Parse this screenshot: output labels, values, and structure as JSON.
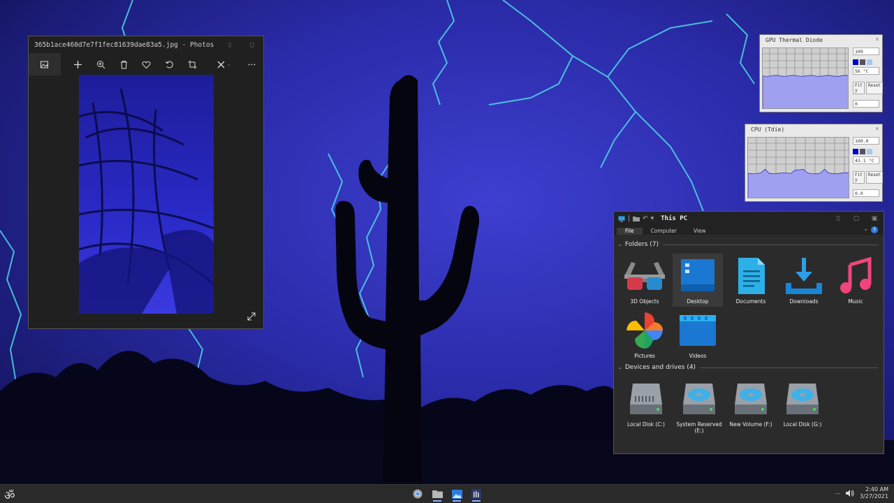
{
  "photos": {
    "title": "365b1ace460d7e7f1fec81639dae83a5.jpg - Photos",
    "toolbar": [
      "image-icon",
      "add-icon",
      "zoom-icon",
      "delete-icon",
      "favorite-icon",
      "rotate-icon",
      "crop-icon",
      "edit-icon",
      "more-icon"
    ]
  },
  "gpu_monitor": {
    "title": "GPU Thermal Diode",
    "max": "100",
    "value": "56 °C",
    "min": "0",
    "fit_label": "Fit y",
    "reset_label": "Reset",
    "fill_level": 0.55,
    "swatch_colors": [
      "#0000c8",
      "#555555",
      "#a8c8f0"
    ]
  },
  "cpu_monitor": {
    "title": "CPU (Tdie)",
    "max": "100.0",
    "value": "43.1 °C",
    "min": "0.0",
    "fit_label": "Fit y",
    "reset_label": "Reset",
    "fill_level": 0.42,
    "swatch_colors": [
      "#0000c8",
      "#555555",
      "#a8c8f0"
    ]
  },
  "explorer": {
    "title": "This PC",
    "tabs": [
      "File",
      "Computer",
      "View"
    ],
    "active_tab": "File",
    "folders_header": "Folders (7)",
    "folders": [
      {
        "label": "3D Objects",
        "icon": "3d-glasses-icon"
      },
      {
        "label": "Desktop",
        "icon": "desktop-icon"
      },
      {
        "label": "Documents",
        "icon": "document-icon"
      },
      {
        "label": "Downloads",
        "icon": "download-icon"
      },
      {
        "label": "Music",
        "icon": "music-icon"
      },
      {
        "label": "Pictures",
        "icon": "pinwheel-icon"
      },
      {
        "label": "Videos",
        "icon": "video-icon"
      }
    ],
    "drives_header": "Devices and drives (4)",
    "drives": [
      {
        "label": "Local Disk (C:)",
        "icon": "hard-drive-icon"
      },
      {
        "label": "System Reserved (E:)",
        "icon": "disc-drive-icon"
      },
      {
        "label": "New Volume (F:)",
        "icon": "disc-drive-icon"
      },
      {
        "label": "Local Disk (G:)",
        "icon": "disc-drive-icon"
      }
    ]
  },
  "taskbar": {
    "start_glyph": "ॐ",
    "apps": [
      "chrome-icon",
      "folder-icon",
      "photos-icon",
      "monitor-app-icon"
    ],
    "time": "2:40 AM",
    "date": "3/27/2021"
  },
  "colors": {
    "sky": "#2a2ba8",
    "lightning": "#4fd8e6",
    "accent": "#8ab4f8"
  }
}
